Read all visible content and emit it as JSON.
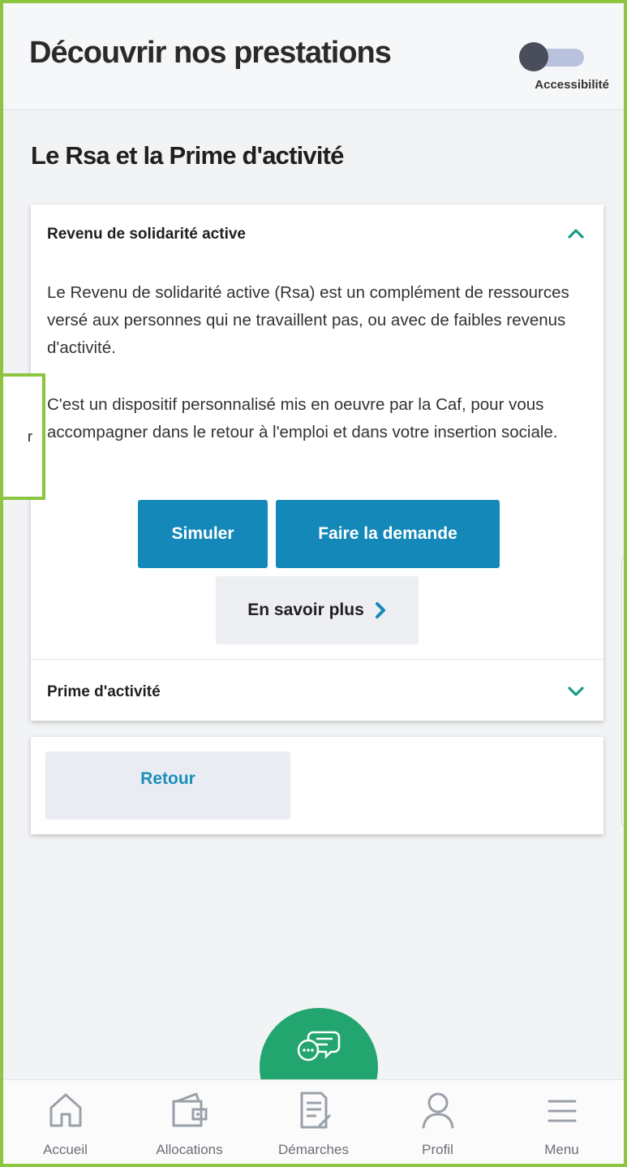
{
  "header": {
    "title": "Découvrir nos prestations",
    "accessibility_label": "Accessibilité",
    "accessibility_enabled": false
  },
  "section": {
    "title": "Le Rsa et la Prime d'activité"
  },
  "accordion": [
    {
      "title": "Revenu de solidarité active",
      "expanded": true,
      "paragraphs": [
        "Le Revenu de solidarité active (Rsa) est un complément de ressources versé aux personnes qui ne travaillent pas, ou avec de faibles revenus d'activité.",
        "C'est un dispositif personnalisé mis en oeuvre par la Caf, pour vous accompagner dans le retour à l'emploi et dans votre insertion sociale."
      ],
      "buttons": {
        "simulate": "Simuler",
        "apply": "Faire la demande",
        "more": "En savoir plus"
      }
    },
    {
      "title": "Prime d'activité",
      "expanded": false
    }
  ],
  "back_button": "Retour",
  "callout_fragment": "r",
  "bottom_nav": [
    {
      "label": "Accueil",
      "icon": "home-icon"
    },
    {
      "label": "Allocations",
      "icon": "wallet-icon"
    },
    {
      "label": "Démarches",
      "icon": "document-icon"
    },
    {
      "label": "Profil",
      "icon": "user-icon"
    },
    {
      "label": "Menu",
      "icon": "menu-icon"
    }
  ],
  "colors": {
    "primary": "#1488b8",
    "accent_green": "#22a56e",
    "teal_chevron": "#1a9a8a",
    "frame_green": "#8cc63f"
  }
}
